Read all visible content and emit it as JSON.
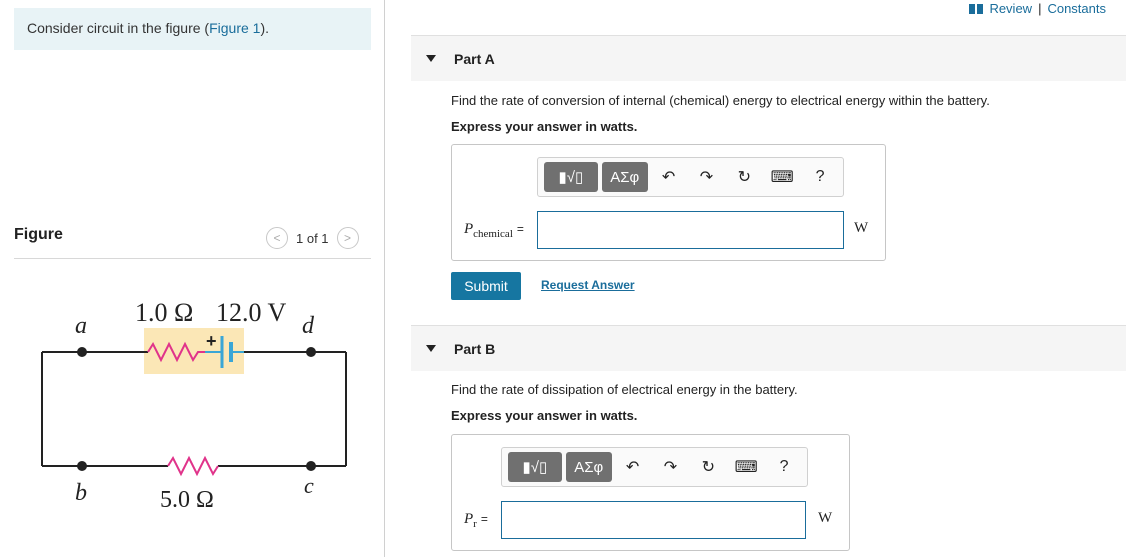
{
  "intro": {
    "text": "Consider circuit in the figure (",
    "link": "Figure 1",
    "end": ")."
  },
  "figure": {
    "title": "Figure",
    "pager": "1 of 1",
    "circuit": {
      "node_a": "a",
      "node_b": "b",
      "node_c": "c",
      "node_d": "d",
      "internal_resistance": "1.0 Ω",
      "emf": "12.0 V",
      "load_resistance": "5.0 Ω",
      "plus_sign": "+"
    }
  },
  "topbar": {
    "review": "Review",
    "sep": "|",
    "constants": "Constants"
  },
  "toolbar": {
    "templates": "▮√▯",
    "greek": "ΑΣφ",
    "help": "?"
  },
  "partA": {
    "title": "Part A",
    "question": "Find the rate of conversion of internal (chemical) energy to electrical energy within the battery.",
    "instruction": "Express your answer in watts.",
    "var": "P",
    "sub": "chemical",
    "eq": "=",
    "unit": "W",
    "value": ""
  },
  "actions": {
    "submit": "Submit",
    "request": "Request Answer"
  },
  "partB": {
    "title": "Part B",
    "question": "Find the rate of dissipation of electrical energy in the battery.",
    "instruction": "Express your answer in watts.",
    "var": "P",
    "sub": "r",
    "eq": "=",
    "unit": "W",
    "value": ""
  },
  "colors": {
    "accent": "#1676a1",
    "resistor": "#e0338a",
    "battery": "#3aa6d6",
    "battery_bg": "#fbe7b6"
  }
}
